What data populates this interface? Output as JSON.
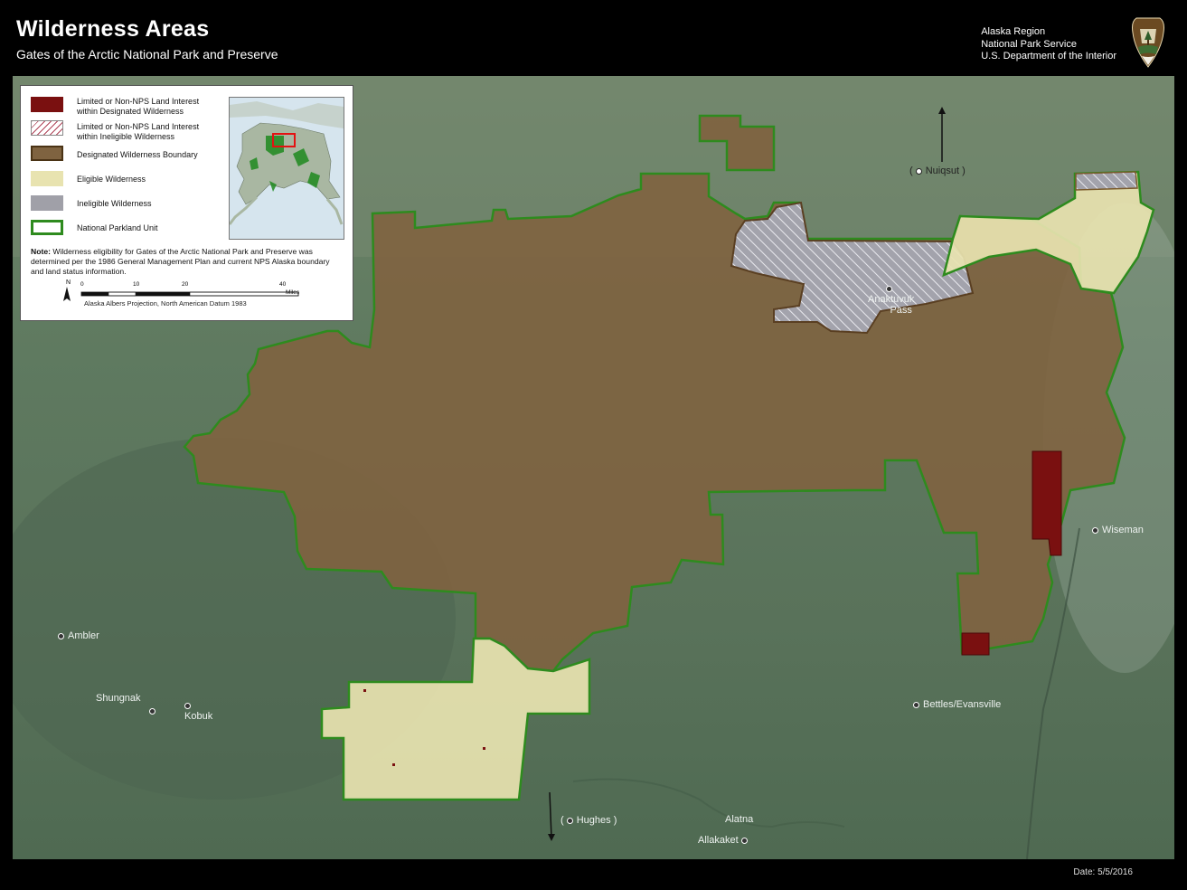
{
  "header": {
    "title": "Wilderness Areas",
    "subtitle": "Gates of the Arctic National Park and Preserve",
    "agency_line1": "Alaska Region",
    "agency_line2": "National Park Service",
    "agency_line3": "U.S. Department of the Interior",
    "logo_icon": "nps-arrowhead-icon"
  },
  "legend": {
    "items": [
      {
        "label_line1": "Limited or Non-NPS Land Interest",
        "label_line2": "within Designated Wilderness",
        "color": "#7a1010"
      },
      {
        "label_line1": "Limited or Non-NPS Land Interest",
        "label_line2": "within Ineligible Wilderness",
        "color": "#ffffff"
      },
      {
        "label_line1": "Designated Wilderness Boundary",
        "label_line2": "",
        "color": "#7f6340"
      },
      {
        "label_line1": "Eligible Wilderness",
        "label_line2": "",
        "color": "#e8e3b0"
      },
      {
        "label_line1": "Ineligible Wilderness",
        "label_line2": "",
        "color": "#a0a0a8"
      },
      {
        "label_line1": "National Parkland Unit",
        "label_line2": "",
        "color": "#2e8b1e"
      }
    ],
    "note_label": "Note:",
    "note_text": "Wilderness eligibility for Gates of the Arctic National Park and Preserve was determined per the 1986 General Management Plan and current NPS Alaska boundary and land status information.",
    "scale_ticks": [
      "0",
      "10",
      "20",
      "40"
    ],
    "scale_unit": "Miles",
    "north_label": "N",
    "projection": "Alaska Albers Projection, North American Datum 1983"
  },
  "places": {
    "nuiqsut": "Nuiqsut",
    "anaktuvuk_line1": "Anaktuvuk",
    "anaktuvuk_line2": "Pass",
    "wiseman": "Wiseman",
    "ambler": "Ambler",
    "shungnak": "Shungnak",
    "kobuk": "Kobuk",
    "bettles": "Bettles/Evansville",
    "hughes": "Hughes",
    "alatna": "Alatna",
    "allakaket": "Allakaket"
  },
  "footer": {
    "date": "Date: 5/5/2016"
  }
}
